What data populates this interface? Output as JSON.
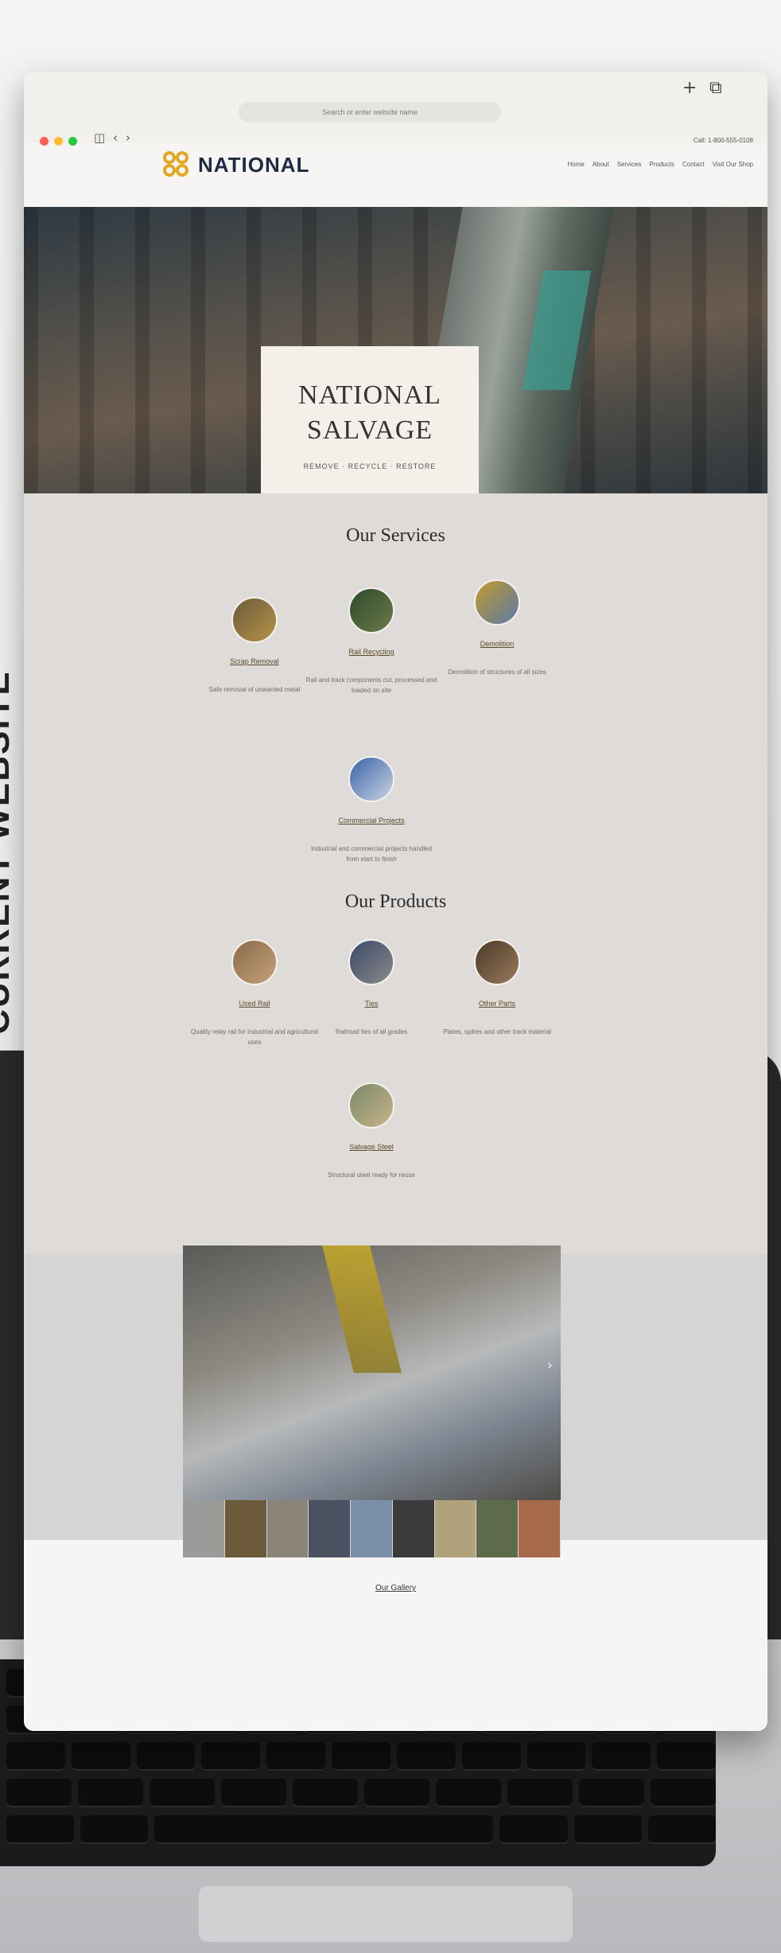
{
  "side_label": "CURRENT WEBSITE",
  "browser": {
    "address_placeholder": "Search or enter website name",
    "nav_back": "‹",
    "nav_forward": "›",
    "sidebar_icon": "◫",
    "new_tab": "+",
    "tabs_icon": "⧉"
  },
  "site": {
    "call_line": "Call: 1-800-555-0108",
    "nav": [
      "Home",
      "About",
      "Services",
      "Products",
      "Contact",
      "Visit Our Shop"
    ],
    "logo_text": "NATIONAL",
    "hero": {
      "title_line1": "NATIONAL",
      "title_line2": "SALVAGE",
      "tagline": "REMOVE · RECYCLE · RESTORE"
    },
    "services_title": "Our Services",
    "services": [
      {
        "label": "Scrap Removal",
        "desc": "Safe removal of unwanted metal",
        "colors": [
          "#6b5a3a",
          "#b8934a"
        ]
      },
      {
        "label": "Rail Recycling",
        "desc": "Rail and track components cut, processed and loaded on site",
        "colors": [
          "#2e4a2c",
          "#6c7b4a"
        ]
      },
      {
        "label": "Demolition",
        "desc": "Demolition of structures of all sizes",
        "colors": [
          "#c19a2d",
          "#5b79a8"
        ]
      },
      {
        "label": "Commercial Projects",
        "desc": "Industrial and commercial projects handled from start to finish",
        "colors": [
          "#3b63a8",
          "#c9d4e2"
        ]
      }
    ],
    "products_title": "Our Products",
    "products": [
      {
        "label": "Used Rail",
        "desc": "Quality relay rail for industrial and agricultural uses",
        "colors": [
          "#8a6a4a",
          "#c4a27a"
        ]
      },
      {
        "label": "Ties",
        "desc": "Railroad ties of all grades",
        "colors": [
          "#3a4a6a",
          "#8a8a8a"
        ]
      },
      {
        "label": "Other Parts",
        "desc": "Plates, spikes and other track material",
        "colors": [
          "#4a3a2a",
          "#9a7a5a"
        ]
      },
      {
        "label": "Salvage Steel",
        "desc": "Structural steel ready for reuse",
        "colors": [
          "#7a8a6a",
          "#c9b38a"
        ]
      }
    ],
    "gallery_link": "Our Gallery",
    "gallery_next": "›",
    "thumb_colors": [
      "#9b9c9a",
      "#6d5a3a",
      "#8a8578",
      "#4a5262",
      "#7c8fa8",
      "#3b3b3b",
      "#b0a27a",
      "#5d6b4a",
      "#a66a4a"
    ]
  }
}
